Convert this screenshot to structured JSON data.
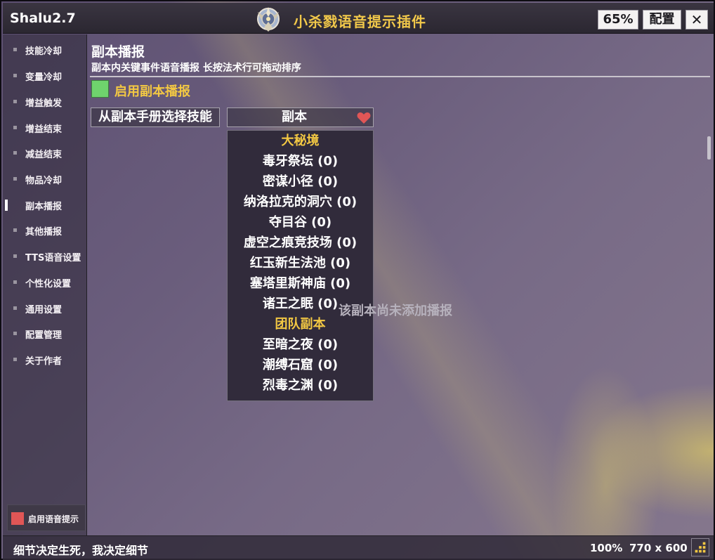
{
  "app": {
    "version": "Shalu2.7",
    "title": "小杀戮语音提示插件",
    "zoom_label": "65%",
    "config_label": "配置",
    "close_label": "✕",
    "emblem_icon": "class-emblem-icon"
  },
  "sidebar": {
    "items": [
      {
        "label": "技能冷却"
      },
      {
        "label": "变量冷却"
      },
      {
        "label": "增益触发"
      },
      {
        "label": "增益结束"
      },
      {
        "label": "减益结束"
      },
      {
        "label": "物品冷却"
      },
      {
        "label": "副本播报",
        "active": true
      },
      {
        "label": "其他播报"
      },
      {
        "label": "TTS语音设置"
      },
      {
        "label": "个性化设置"
      },
      {
        "label": "通用设置"
      },
      {
        "label": "配置管理"
      },
      {
        "label": "关于作者"
      }
    ],
    "voice_toggle": {
      "label": "启用语音提示",
      "enabled": false,
      "color": "#e05656"
    }
  },
  "main": {
    "title": "副本播报",
    "description": "副本内关键事件语音播报  长按法术行可拖动排序",
    "enable": {
      "label": "启用副本播报",
      "enabled": true,
      "color": "#6fd36d"
    },
    "select_skill_button": "从副本手册选择技能",
    "dungeon_select": {
      "value": "副本",
      "icon": "heart-icon",
      "icon_color": "#e05656"
    },
    "dropdown": {
      "rows": [
        {
          "label": "大秘境",
          "header": true
        },
        {
          "label": "毒牙祭坛 (0)"
        },
        {
          "label": "密谋小径 (0)"
        },
        {
          "label": "纳洛拉克的洞穴 (0)"
        },
        {
          "label": "夺目谷 (0)"
        },
        {
          "label": "虚空之痕竞技场 (0)"
        },
        {
          "label": "红玉新生法池 (0)"
        },
        {
          "label": "塞塔里斯神庙 (0)"
        },
        {
          "label": "诸王之眠 (0)"
        },
        {
          "label": "团队副本",
          "header": true
        },
        {
          "label": "至暗之夜 (0)"
        },
        {
          "label": "潮缚石窟 (0)"
        },
        {
          "label": "烈毒之渊 (0)"
        }
      ]
    },
    "empty_message": "该副本尚未添加播报"
  },
  "status": {
    "motto": "细节决定生死，我决定细节",
    "scale": "100%",
    "size": "770 x 600"
  },
  "colors": {
    "accent_gold": "#f3c843",
    "title_gold": "#f1c84a"
  }
}
